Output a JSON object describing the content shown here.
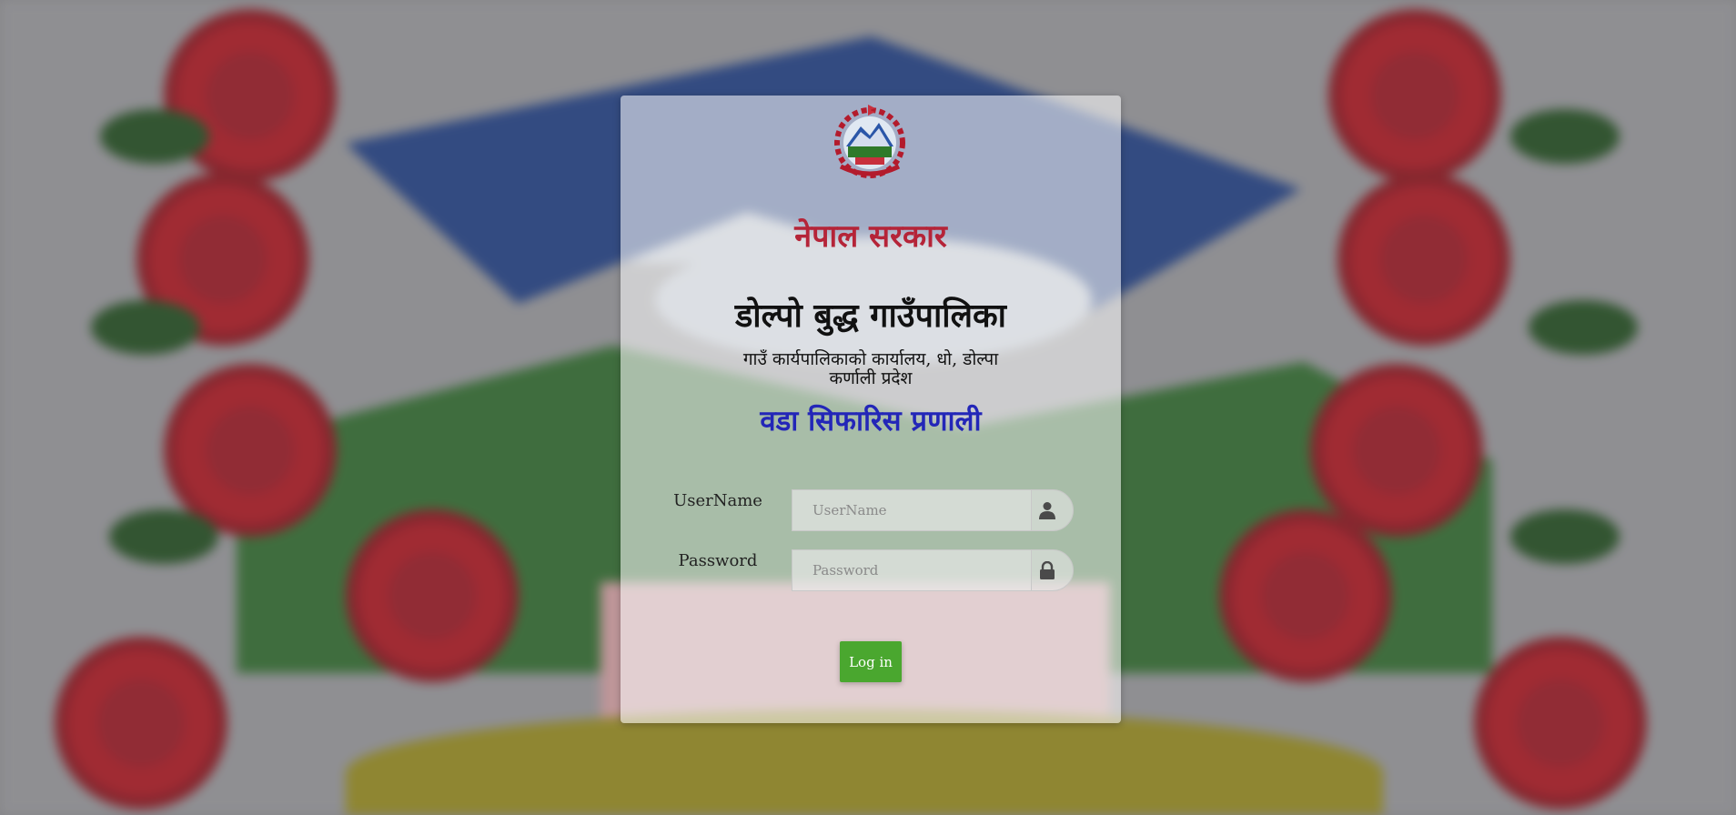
{
  "header": {
    "government": "नेपाल सरकार",
    "municipality": "डोल्पो बुद्ध गाउँपालिका",
    "office_line1": "गाउँ कार्यपालिकाको कार्यालय, धो, डोल्पा",
    "office_line2": "कर्णाली प्रदेश",
    "system_name": "वडा सिफारिस प्रणाली"
  },
  "form": {
    "username_label": "UserName",
    "username_placeholder": "UserName",
    "username_value": "",
    "password_label": "Password",
    "password_placeholder": "Password",
    "password_value": "",
    "login_button": "Log in"
  },
  "icons": {
    "emblem": "nepal-emblem-icon",
    "username": "user-icon",
    "password": "lock-icon"
  },
  "colors": {
    "government_title": "#b52438",
    "system_title": "#2326b8",
    "login_button": "#4aa72f"
  }
}
